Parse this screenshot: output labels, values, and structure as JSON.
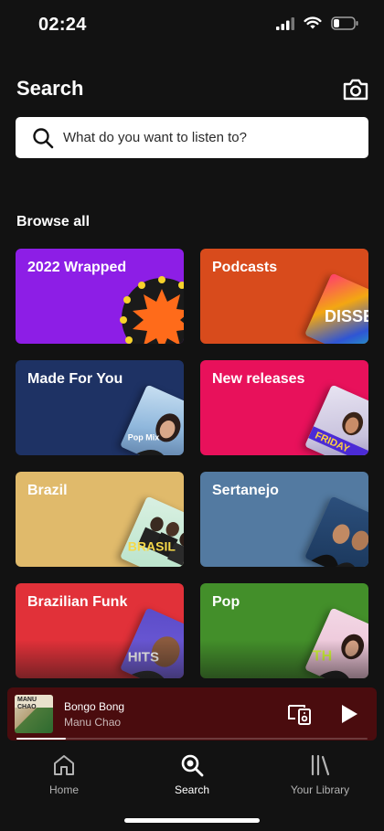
{
  "status_bar": {
    "time": "02:24"
  },
  "header": {
    "title": "Search",
    "camera_icon": "camera-icon"
  },
  "search": {
    "placeholder": "What do you want to listen to?"
  },
  "browse": {
    "title": "Browse all",
    "tiles": [
      {
        "label": "2022 Wrapped",
        "color": "#8d1ee6"
      },
      {
        "label": "Podcasts",
        "color": "#d84b1c"
      },
      {
        "label": "Made For You",
        "color": "#1e3264"
      },
      {
        "label": "New releases",
        "color": "#e8115b"
      },
      {
        "label": "Brazil",
        "color": "#e0ba6b"
      },
      {
        "label": "Sertanejo",
        "color": "#537aa1"
      },
      {
        "label": "Brazilian Funk",
        "color": "#e13139"
      },
      {
        "label": "Pop",
        "color": "#438f2a"
      }
    ],
    "art_text": {
      "made_for_you": "Pop Mix",
      "brazil": "BRASIL",
      "funk": "HITS",
      "pop": "TH"
    }
  },
  "now_playing": {
    "title": "Bongo Bong",
    "artist": "Manu Chao",
    "progress": 0.14,
    "cover_text": "MANU CHAO"
  },
  "nav": {
    "home": "Home",
    "search": "Search",
    "library": "Your Library"
  }
}
